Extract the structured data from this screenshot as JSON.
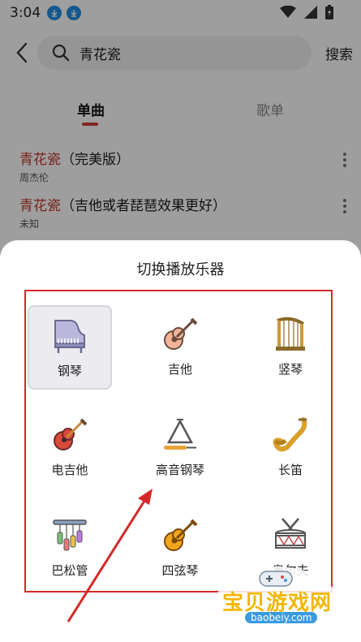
{
  "status_bar": {
    "time": "3:04"
  },
  "search": {
    "query": "青花瓷",
    "button": "搜索"
  },
  "tabs": [
    {
      "label": "单曲",
      "active": true
    },
    {
      "label": "歌单",
      "active": false
    }
  ],
  "songs": [
    {
      "title_highlight": "青花瓷",
      "title_rest": "（完美版）",
      "artist": "周杰伦"
    },
    {
      "title_highlight": "青花瓷",
      "title_rest": "（吉他或者琵琶效果更好）",
      "artist": "未知"
    }
  ],
  "sheet": {
    "title": "切换播放乐器",
    "instruments": [
      {
        "label": "钢琴",
        "icon": "piano-icon",
        "selected": true
      },
      {
        "label": "吉他",
        "icon": "guitar-icon",
        "selected": false
      },
      {
        "label": "竖琴",
        "icon": "harp-icon",
        "selected": false
      },
      {
        "label": "电吉他",
        "icon": "electric-guitar-icon",
        "selected": false
      },
      {
        "label": "高音钢琴",
        "icon": "triangle-icon",
        "selected": false
      },
      {
        "label": "长笛",
        "icon": "saxophone-icon",
        "selected": false
      },
      {
        "label": "巴松管",
        "icon": "wind-chimes-icon",
        "selected": false
      },
      {
        "label": "四弦琴",
        "icon": "ukulele-icon",
        "selected": false
      },
      {
        "label": "奥尔夫",
        "icon": "drum-icon",
        "selected": false
      }
    ]
  },
  "watermark": {
    "text": "宝贝游戏网",
    "url": "baobeiy.com"
  },
  "colors": {
    "accent": "#d33a3a",
    "annotation": "#d62828",
    "watermark": "#f2b705"
  }
}
